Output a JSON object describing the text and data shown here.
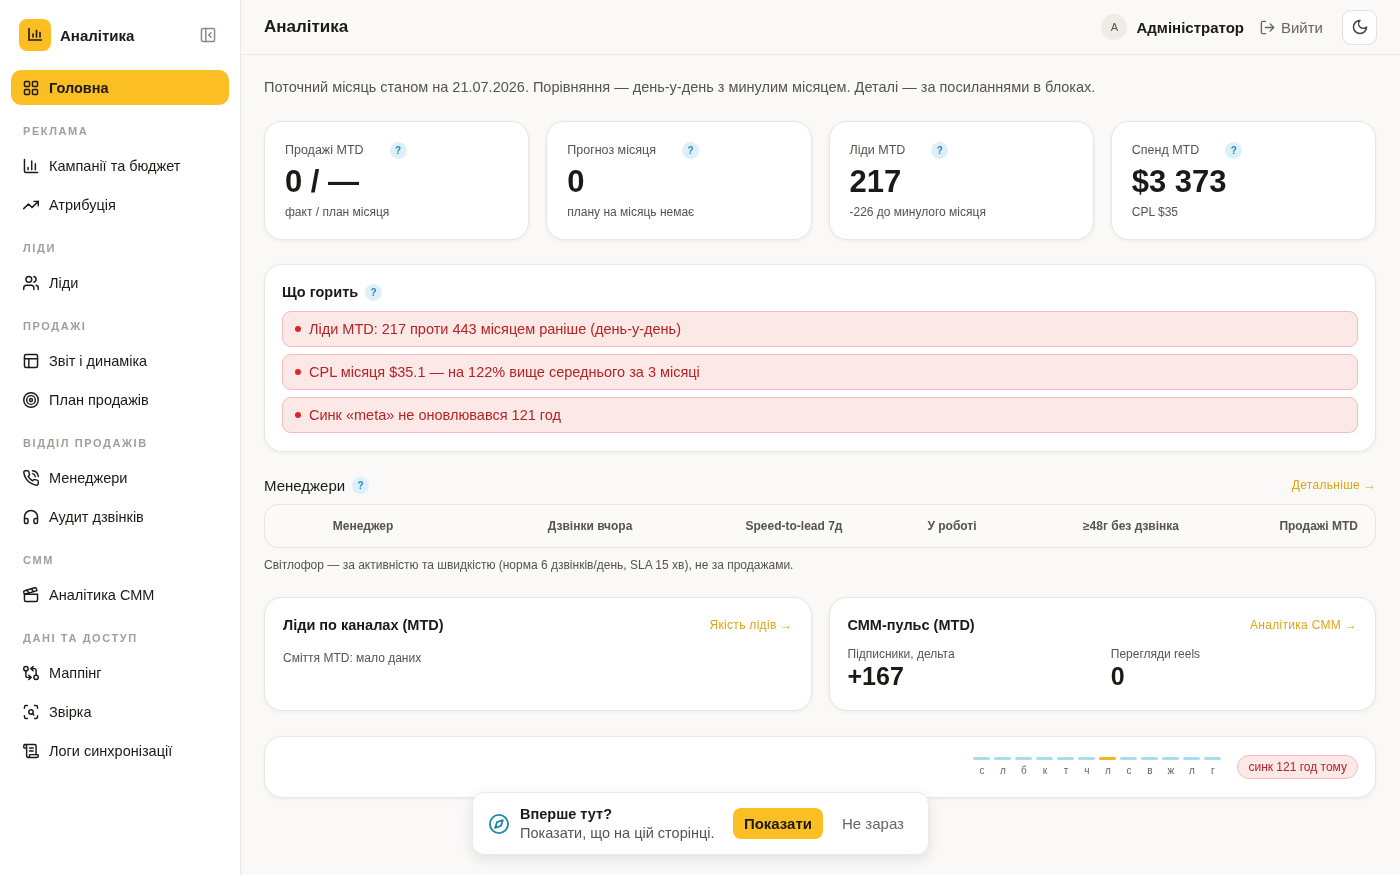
{
  "sidebar": {
    "title": "Аналітика",
    "items": [
      {
        "kind": "link",
        "label": "Головна",
        "selected": true
      },
      {
        "kind": "heading",
        "label": "РЕКЛАМА"
      },
      {
        "kind": "link",
        "label": "Кампанії та бюджет",
        "selected": false
      },
      {
        "kind": "link",
        "label": "Атрибуція",
        "selected": false
      },
      {
        "kind": "heading",
        "label": "ЛІДИ"
      },
      {
        "kind": "link",
        "label": "Ліди",
        "selected": false
      },
      {
        "kind": "heading",
        "label": "ПРОДАЖІ"
      },
      {
        "kind": "link",
        "label": "Звіт і динаміка",
        "selected": false
      },
      {
        "kind": "link",
        "label": "План продажів",
        "selected": false
      },
      {
        "kind": "heading",
        "label": "ВІДДІЛ ПРОДАЖІВ"
      },
      {
        "kind": "link",
        "label": "Менеджери",
        "selected": false
      },
      {
        "kind": "link",
        "label": "Аудит дзвінків",
        "selected": false
      },
      {
        "kind": "heading",
        "label": "СММ"
      },
      {
        "kind": "link",
        "label": "Аналітика СММ",
        "selected": false
      },
      {
        "kind": "heading",
        "label": "ДАНІ ТА ДОСТУП"
      },
      {
        "kind": "link",
        "label": "Маппінг",
        "selected": false
      },
      {
        "kind": "link",
        "label": "Звірка",
        "selected": false
      },
      {
        "kind": "link",
        "label": "Логи синхронізації",
        "selected": false
      }
    ]
  },
  "header": {
    "title": "Аналітика",
    "user": {
      "initial": "А",
      "name": "Адміністратор"
    },
    "logout": "Вийти"
  },
  "intro": "Поточний місяць станом на 21.07.2026. Порівняння — день-у-день з минулим місяцем. Деталі — за посиланнями в блоках.",
  "kpis": [
    {
      "label": "Продажі MTD",
      "help": "?",
      "value": "0 / —",
      "note": "факт / план місяця"
    },
    {
      "label": "Прогноз місяця",
      "help": "?",
      "value": "0",
      "note": "плану на місяць немає"
    },
    {
      "label": "Ліди MTD",
      "help": "?",
      "value": "217",
      "note": "-226 до минулого місяця"
    },
    {
      "label": "Спенд MTD",
      "help": "?",
      "value": "$3 373",
      "note": "CPL $35"
    }
  ],
  "alerts": {
    "title": "Що горить",
    "help": "?",
    "items": [
      "Ліди MTD: 217 проти 443 місяцем раніше (день-у-день)",
      "CPL місяця $35.1 — на 122% вище середнього за 3 місяці",
      "Синк «meta» не оновлювався 121 год"
    ]
  },
  "managers": {
    "title": "Менеджери",
    "help": "?",
    "link": "Детальніше →",
    "table": {
      "columns": [
        "Менеджер",
        "Дзвінки вчора",
        "Speed-to-lead 7д",
        "У роботі",
        "≥48г без дзвінка",
        "Продажі MTD"
      ]
    },
    "note": "Світлофор — за активністю та швидкістю (норма 6 дзвінків/день, SLA 15 хв), не за продажами."
  },
  "channels": {
    "title": "Ліди по каналах (MTD)",
    "link": "Якість лідів →",
    "note": "Сміття MTD: мало даних"
  },
  "smm": {
    "title": "СММ-пульс (MTD)",
    "link": "Аналітика СММ →",
    "metrics": [
      {
        "label": "Підписники, дельта",
        "value": "+167"
      },
      {
        "label": "Перегляди reels",
        "value": "0"
      }
    ]
  },
  "sync": {
    "months": [
      {
        "label": "с",
        "color": "#a9dcee"
      },
      {
        "label": "л",
        "color": "#a9dcee"
      },
      {
        "label": "б",
        "color": "#a9dcee"
      },
      {
        "label": "к",
        "color": "#a9dcee"
      },
      {
        "label": "т",
        "color": "#a9dcee"
      },
      {
        "label": "ч",
        "color": "#a9dcee"
      },
      {
        "label": "л",
        "color": "#f5b324"
      },
      {
        "label": "с",
        "color": "#a9dcee"
      },
      {
        "label": "в",
        "color": "#a9dcee"
      },
      {
        "label": "ж",
        "color": "#a9dcee"
      },
      {
        "label": "л",
        "color": "#a9dcee"
      },
      {
        "label": "г",
        "color": "#a9dcee"
      }
    ],
    "status": "синк 121 год тому"
  },
  "tour": {
    "title": "Вперше тут?",
    "text": "Показати, що на цій сторінці.",
    "primary": "Показати",
    "secondary": "Не зараз"
  }
}
